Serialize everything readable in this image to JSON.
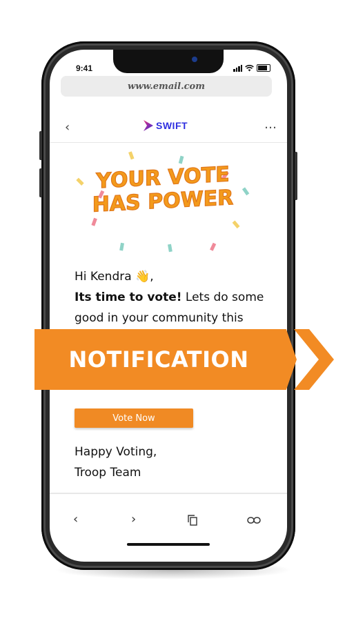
{
  "status_bar": {
    "time": "9:41"
  },
  "browser": {
    "url": "www.email.com"
  },
  "email_header": {
    "logo_text": "SWIFT"
  },
  "hero": {
    "line1": "YOUR VOTE",
    "line2": "HAS POWER"
  },
  "email_body": {
    "greeting": "Hi Kendra",
    "greeting_emoji": "👋",
    "greeting_punct": ",",
    "headline_bold": "Its time to vote!",
    "headline_rest": " Lets do some good in your community this",
    "cta_label": "Vote Now",
    "signoff_line1": "Happy Voting,",
    "signoff_line2": "Troop Team"
  },
  "banner": {
    "label": "NOTIFICATION"
  },
  "colors": {
    "accent": "#f28b24",
    "brand_blue": "#2f2fe0",
    "hero_text": "#f39a1b",
    "phone_frame": "#2a2a2a"
  },
  "icons": {
    "nav_back": "chevron-left-icon",
    "nav_more": "more-dots-icon",
    "toolbar": [
      "back-arrow-icon",
      "forward-arrow-icon",
      "copy-icon",
      "link-icon"
    ]
  }
}
